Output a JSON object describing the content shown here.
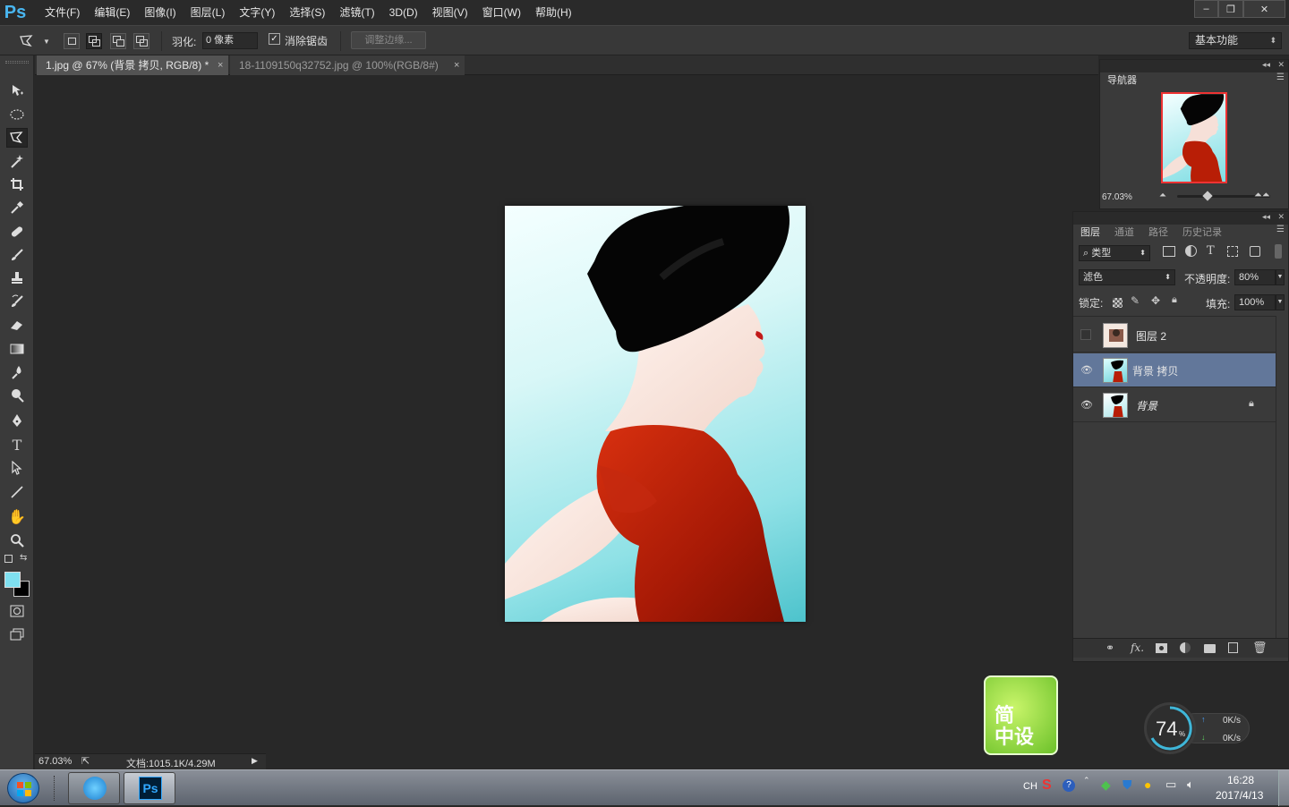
{
  "app": {
    "logo": "Ps"
  },
  "menu": [
    "文件(F)",
    "编辑(E)",
    "图像(I)",
    "图层(L)",
    "文字(Y)",
    "选择(S)",
    "滤镜(T)",
    "3D(D)",
    "视图(V)",
    "窗口(W)",
    "帮助(H)"
  ],
  "window_controls": {
    "minimize": "–",
    "restore": "❐",
    "close": "✕"
  },
  "options": {
    "feather_label": "羽化:",
    "feather_value": "0 像素",
    "antialias_label": "消除锯齿",
    "antialias_checked": "✓",
    "refine_edge": "调整边缘...",
    "workspace": "基本功能"
  },
  "tabs": [
    {
      "label": "1.jpg @ 67% (背景 拷贝, RGB/8) *",
      "close": "×"
    },
    {
      "label": "18-1109150q32752.jpg @ 100%(RGB/8#)",
      "close": "×"
    }
  ],
  "status": {
    "zoom": "67.03%",
    "doc": "文档:1015.1K/4.29M"
  },
  "navigator": {
    "title": "导航器",
    "zoom": "67.03%"
  },
  "layers_panel": {
    "tabs": [
      "图层",
      "通道",
      "路径",
      "历史记录"
    ],
    "filter_kind": "类型",
    "blend_mode": "滤色",
    "opacity_label": "不透明度:",
    "opacity": "80%",
    "lock_label": "锁定:",
    "fill_label": "填充:",
    "fill": "100%",
    "layers": [
      {
        "name": "图层 2",
        "visible": false,
        "selected": false
      },
      {
        "name": "背景 拷贝",
        "visible": true,
        "selected": true
      },
      {
        "name": "背景",
        "visible": true,
        "selected": false,
        "locked": true
      }
    ],
    "footer_icons": [
      "link-icon",
      "fx-icon",
      "mask-icon",
      "adjustment-icon",
      "folder-icon",
      "new-layer-icon",
      "trash-icon"
    ],
    "fx_label": "fx."
  },
  "widgets": {
    "logo_text_1": "简",
    "logo_text_2": "中设",
    "speed_percent": "74",
    "speed_unit": "%",
    "upload": "0K/s",
    "download": "0K/s"
  },
  "taskbar": {
    "time": "16:28",
    "date": "2017/4/13",
    "ime": "CH",
    "ps_label": "Ps"
  },
  "colors": {
    "foreground": "#7fe0f0",
    "background": "#000000",
    "accent_selected": "#62779a"
  }
}
